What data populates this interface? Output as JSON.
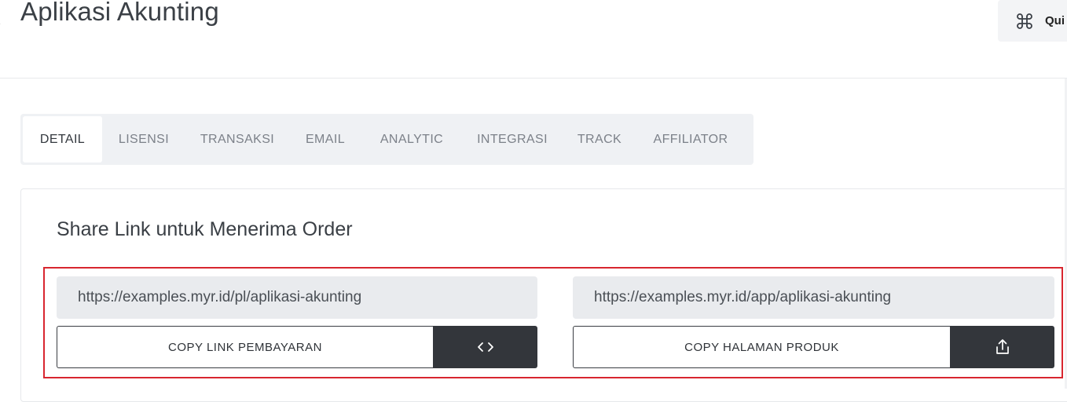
{
  "header": {
    "title": "Aplikasi Akunting",
    "quick_button_label": "Qui"
  },
  "tabs": [
    {
      "label": "DETAIL",
      "active": true
    },
    {
      "label": "LISENSI",
      "active": false
    },
    {
      "label": "TRANSAKSI",
      "active": false
    },
    {
      "label": "EMAIL",
      "active": false
    },
    {
      "label": "ANALYTIC",
      "active": false
    },
    {
      "label": "INTEGRASI",
      "active": false
    },
    {
      "label": "TRACK",
      "active": false
    },
    {
      "label": "AFFILIATOR",
      "active": false
    }
  ],
  "share": {
    "title": "Share Link untuk Menerima Order",
    "payment": {
      "url": "https://examples.myr.id/pl/aplikasi-akunting",
      "button_label": "COPY LINK PEMBAYARAN",
      "icon": "code-icon"
    },
    "product": {
      "url": "https://examples.myr.id/app/aplikasi-akunting",
      "button_label": "COPY HALAMAN PRODUK",
      "icon": "share-upload-icon"
    }
  },
  "colors": {
    "highlight_border": "#d8262f",
    "dark_button": "#33363b",
    "tab_bar_bg": "#eff1f4",
    "field_bg": "#e9ebee"
  }
}
